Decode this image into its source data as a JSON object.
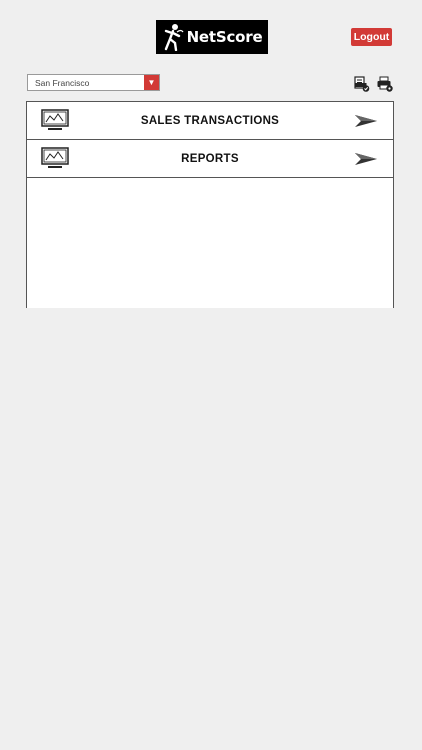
{
  "header": {
    "logo_text": "NetScore",
    "logout_label": "Logout"
  },
  "location_select": {
    "value": "San Francisco"
  },
  "toolbar": {
    "icons": [
      "document-check-icon",
      "printer-settings-icon"
    ]
  },
  "menu": {
    "items": [
      {
        "label": "SALES TRANSACTIONS",
        "icon": "monitor-chart-icon"
      },
      {
        "label": "REPORTS",
        "icon": "monitor-chart-icon"
      }
    ]
  },
  "colors": {
    "accent": "#d23a36",
    "logo_bg": "#000000",
    "page_bg": "#efefef"
  }
}
